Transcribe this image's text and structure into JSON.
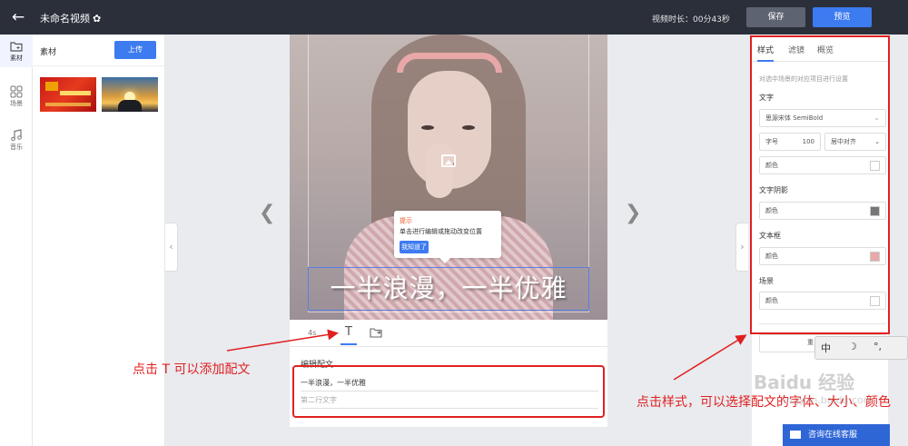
{
  "header": {
    "title": "未命名视频",
    "settings_icon": "gear-icon",
    "duration": "视频时长：00分43秒",
    "save_label": "保存",
    "preview_label": "预览"
  },
  "rail": [
    {
      "label": "素材",
      "icon": "folder-plus-icon",
      "active": true
    },
    {
      "label": "场景",
      "icon": "grid-icon",
      "active": false
    },
    {
      "label": "音乐",
      "icon": "music-icon",
      "active": false
    }
  ],
  "materials": {
    "title": "素材",
    "upload_label": "上传"
  },
  "tooltip": {
    "title": "提示",
    "text": "单击进行编辑或拖动改变位置",
    "button": "我知道了"
  },
  "caption": "一半浪漫，一半优雅",
  "editor": {
    "tab_duration": "4s",
    "tab_text": "T",
    "label": "编辑配文",
    "line1_value": "一半浪漫，一半优雅",
    "line2_placeholder": "第二行文字"
  },
  "right_panel": {
    "tabs": [
      "样式",
      "滤镜",
      "概览"
    ],
    "hint": "对选中场景的对应项目进行设置",
    "text_section": "文字",
    "font_value": "思源宋体 SemiBold",
    "size_label": "字号",
    "size_value": "100",
    "align_value": "居中对齐",
    "color_label": "颜色",
    "shadow_section": "文字阴影",
    "textbox_section": "文本框",
    "scene_section": "场景",
    "partial_text": "重",
    "colors": {
      "text": "#ffffff",
      "shadow": "#777777",
      "textbox": "#e8a8a8",
      "scene": "#ffffff"
    }
  },
  "annotations": {
    "left": "点击 T 可以添加配文",
    "right": "点击样式，可以选择配文的字体、大小、颜色"
  },
  "ime": [
    "中",
    "☽",
    "°,"
  ],
  "chat_label": "咨询在线客服",
  "watermark": "Baidu 经验",
  "watermark_sub": "jingyan.baidu.com"
}
